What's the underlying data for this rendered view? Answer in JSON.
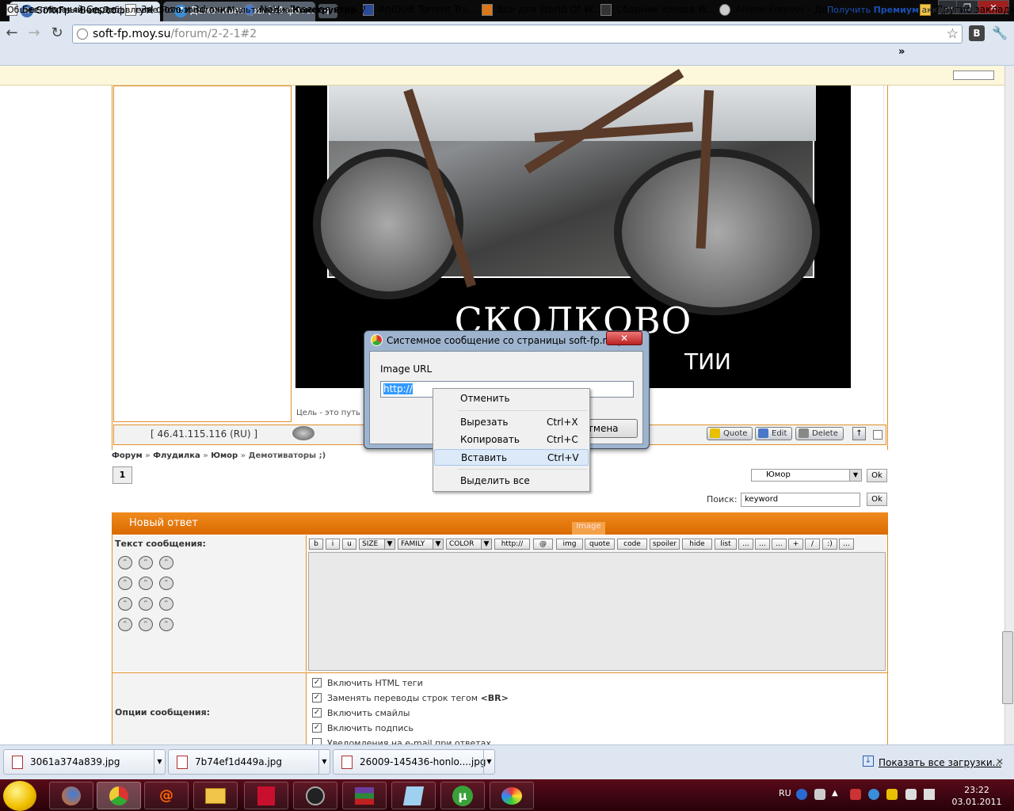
{
  "browser": {
    "tabs": [
      {
        "title": "Soft-Fp - Весь софт тут!",
        "active": true,
        "icon": "globe-icon"
      },
      {
        "title": "Демотиваторы (44 фото...",
        "active": false,
        "icon": "z-icon"
      }
    ],
    "new_tab": "+",
    "window_buttons": {
      "minimize": "—",
      "maximize": "❐",
      "close": "✕"
    },
    "address": {
      "host": "soft-fp.moy.su",
      "path": "/forum/2-2-1#2"
    },
    "nav": {
      "back": "←",
      "forward": "→",
      "reload": "↻"
    },
    "star": "☆",
    "vk_button": "B",
    "wrench": "🔧",
    "bookmarks": [
      "Бесплатный Серве...",
      "3d фото и 3d очки ...",
      "NoH - Главная стра...",
      "AniDUB Torrent Tra...",
      "Все для World Of W...",
      "Сборник юмора W...",
      "Anime-Forever - До..."
    ],
    "bookmarks_overflow": "»",
    "other_bookmarks": "Другие закладки"
  },
  "ucoz_panel": {
    "menu": [
      "Общее",
      "Управление",
      "Добавление",
      "Пользователи",
      "Мультимедиа",
      "Конструктор",
      "?"
    ],
    "premium_prefix": "Получить",
    "premium_bold": "Премиум",
    "premium_suffix": "аккаунт"
  },
  "post": {
    "demotivator_title": "СКОЛКОВО",
    "demotivator_subtitle": "ТИИ",
    "caption": "Цель - это путь",
    "ip": "[ 46.41.115.116 (RU) ]",
    "buttons": {
      "quote": "Quote",
      "edit": "Edit",
      "delete": "Delete"
    }
  },
  "breadcrumb": {
    "items": [
      "Форум",
      "Флудилка",
      "Юмор"
    ],
    "separator": "»",
    "current": "Демотиваторы ;)"
  },
  "pagination": {
    "current_page": "1"
  },
  "forum_jump": {
    "selected": "Юмор",
    "ok": "Ok"
  },
  "search": {
    "label": "Поиск:",
    "value": "keyword",
    "ok": "Ok"
  },
  "reply": {
    "header": "Новый ответ",
    "image_tip": "Image",
    "message_label": "Текст сообщения:",
    "bbcodes": [
      "b",
      "i",
      "u",
      "SIZE",
      "FAMILY",
      "COLOR",
      "http://",
      "@",
      "img",
      "quote",
      "code",
      "spoiler",
      "hide",
      "list",
      "...",
      "...",
      "...",
      "+",
      "/",
      ":)",
      "..."
    ],
    "options_label": "Опции сообщения:",
    "options": [
      {
        "label": "Включить HTML теги",
        "checked": true
      },
      {
        "label": "Заменять переводы строк тегом ",
        "bold_suffix": "<BR>",
        "checked": true
      },
      {
        "label": "Включить смайлы",
        "checked": true
      },
      {
        "label": "Включить подпись",
        "checked": true
      },
      {
        "label": "Уведомления на e-mail при ответах",
        "checked": false
      }
    ]
  },
  "dialog": {
    "title": "Системное сообщение со страницы soft-fp.moy....",
    "close": "✕",
    "label": "Image URL",
    "input_value": "http://",
    "cancel": "Отмена"
  },
  "context_menu": {
    "undo": {
      "label": "Отменить",
      "shortcut": ""
    },
    "cut": {
      "label": "Вырезать",
      "shortcut": "Ctrl+X"
    },
    "copy": {
      "label": "Копировать",
      "shortcut": "Ctrl+C"
    },
    "paste": {
      "label": "Вставить",
      "shortcut": "Ctrl+V"
    },
    "select_all": {
      "label": "Выделить все",
      "shortcut": ""
    }
  },
  "downloads": {
    "items": [
      "3061a374a839.jpg",
      "7b74ef1d449a.jpg",
      "26009-145436-honlo....jpg"
    ],
    "show_all": "Показать все загрузки...",
    "close": "✕"
  },
  "taskbar": {
    "language": "RU",
    "time": "23:22",
    "date": "03.01.2011"
  }
}
